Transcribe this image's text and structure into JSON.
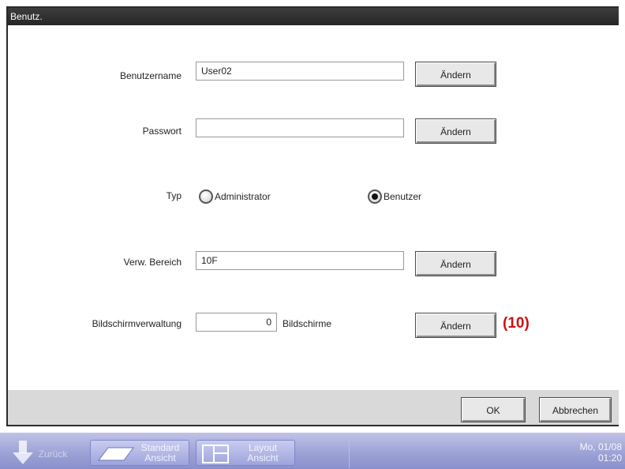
{
  "window": {
    "title": "Benutz."
  },
  "form": {
    "username": {
      "label": "Benutzername",
      "value": "User02",
      "button": "Ändern"
    },
    "password": {
      "label": "Passwort",
      "value": "",
      "button": "Ändern"
    },
    "type": {
      "label": "Typ",
      "options": [
        {
          "label": "Administrator",
          "selected": false
        },
        {
          "label": "Benutzer",
          "selected": true
        }
      ]
    },
    "area": {
      "label": "Verw. Bereich",
      "value": "10F",
      "button": "Ändern"
    },
    "screens": {
      "label": "Bildschirmverwaltung",
      "value": "0",
      "unit": "Bildschirme",
      "button": "Ändern",
      "annotation": "(10)"
    }
  },
  "footer": {
    "ok": "OK",
    "cancel": "Abbrechen"
  },
  "taskbar": {
    "back": "Zurück",
    "standard": [
      "Standard",
      "Ansicht"
    ],
    "layout": [
      "Layout",
      "Ansicht"
    ],
    "date": "Mo, 01/08",
    "time": "01:20"
  },
  "colors": {
    "annotation": "#cc1111",
    "taskbar": "#9da3d6",
    "titlebar": "#2a2a2a"
  }
}
